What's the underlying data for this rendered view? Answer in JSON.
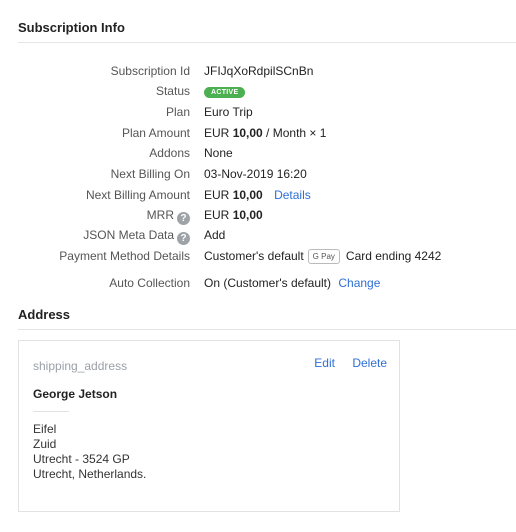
{
  "colors": {
    "accent": "#2f6fd6",
    "active": "#4caf50"
  },
  "sections": {
    "subscription_title": "Subscription Info",
    "address_title": "Address"
  },
  "subscription": {
    "subscription_id": {
      "label": "Subscription Id",
      "value": "JFIJqXoRdpilSCnBn"
    },
    "status": {
      "label": "Status",
      "value": "ACTIVE"
    },
    "plan": {
      "label": "Plan",
      "value": "Euro Trip"
    },
    "plan_amount": {
      "label": "Plan Amount",
      "currency": "EUR",
      "amount": "10,00",
      "suffix": " / Month × 1"
    },
    "addons": {
      "label": "Addons",
      "value": "None"
    },
    "next_billing_on": {
      "label": "Next Billing On",
      "value": "03-Nov-2019 16:20"
    },
    "next_billing_amount": {
      "label": "Next Billing Amount",
      "currency": "EUR",
      "amount": "10,00",
      "details_link": "Details"
    },
    "mrr": {
      "label": "MRR",
      "currency": "EUR",
      "amount": "10,00"
    },
    "json_meta": {
      "label": "JSON Meta Data",
      "add_link": "Add"
    },
    "payment_method": {
      "label": "Payment Method Details",
      "value": "Customer's default",
      "gpay": "G Pay",
      "card": "Card ending 4242"
    },
    "auto_collection": {
      "label": "Auto Collection",
      "value": "On (Customer's default)",
      "change_link": "Change"
    }
  },
  "address": {
    "tag": "shipping_address",
    "edit": "Edit",
    "delete": "Delete",
    "name": "George Jetson",
    "line1": "Eifel",
    "line2": "Zuid",
    "line3": "Utrecht - 3524 GP",
    "line4": "Utrecht, Netherlands."
  },
  "icons": {
    "help": "question-circle-icon"
  }
}
